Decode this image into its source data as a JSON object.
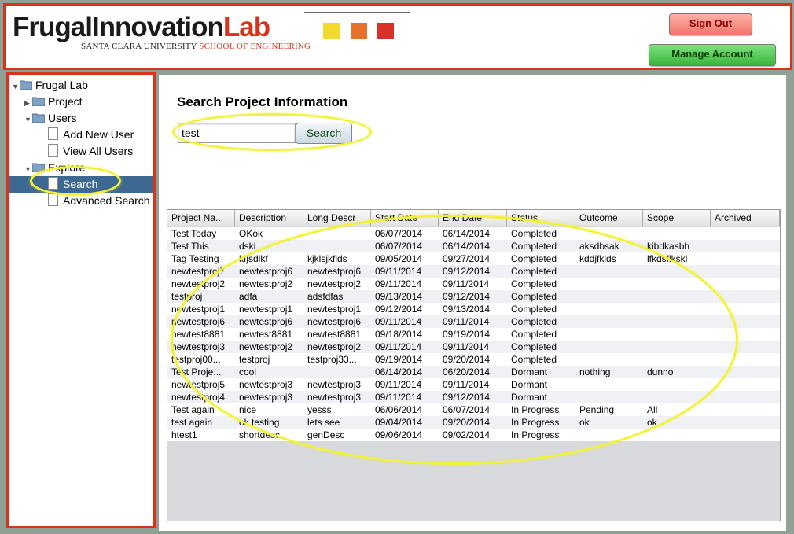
{
  "header": {
    "logo_part1": "FrugalInnovation",
    "logo_part2": "Lab",
    "logo_sub1": "SANTA CLARA UNIVERSITY",
    "logo_sub2": "SCHOOL OF ENGINEERING",
    "squares": [
      "#f2d92a",
      "#e8702a",
      "#d8302a"
    ],
    "signout_label": "Sign Out",
    "manage_label": "Manage Account"
  },
  "tree": {
    "root": "Frugal Lab",
    "project": "Project",
    "users": "Users",
    "add_user": "Add New User",
    "view_users": "View All Users",
    "explore": "Explore",
    "search": "Search",
    "advanced_search": "Advanced Search"
  },
  "main": {
    "title": "Search Project Information",
    "search_value": "test",
    "search_button": "Search"
  },
  "table": {
    "columns": [
      "Project Na...",
      "Description",
      "Long Descr",
      "Start Date",
      "End Date",
      "Status",
      "Outcome",
      "Scope",
      "Archived"
    ],
    "rows": [
      [
        "Test Today",
        "OKok",
        "",
        "06/07/2014",
        "06/14/2014",
        "Completed",
        "",
        "",
        ""
      ],
      [
        "Test This",
        "dski",
        "",
        "06/07/2014",
        "06/14/2014",
        "Completed",
        "aksdbsak",
        "kibdkasbh",
        ""
      ],
      [
        "Tag Testing",
        "kfjsdlkf",
        "kjklsjkflds",
        "09/05/2014",
        "09/27/2014",
        "Completed",
        "kddjfklds",
        "lfkdsflkskl",
        ""
      ],
      [
        "newtestproj7",
        "newtestproj6",
        "newtestproj6",
        "09/11/2014",
        "09/12/2014",
        "Completed",
        "",
        "",
        ""
      ],
      [
        "newtestproj2",
        "newtestproj2",
        "newtestproj2",
        "09/11/2014",
        "09/11/2014",
        "Completed",
        "",
        "",
        ""
      ],
      [
        "testproj",
        "adfa",
        "adsfdfas",
        "09/13/2014",
        "09/12/2014",
        "Completed",
        "",
        "",
        ""
      ],
      [
        "newtestproj1",
        "newtestproj1",
        "newtestproj1",
        "09/12/2014",
        "09/13/2014",
        "Completed",
        "",
        "",
        ""
      ],
      [
        "newtestproj6",
        "newtestproj6",
        "newtestproj6",
        "09/11/2014",
        "09/11/2014",
        "Completed",
        "",
        "",
        ""
      ],
      [
        "newtest8881",
        "newtest8881",
        "newtest8881",
        "09/18/2014",
        "09/19/2014",
        "Completed",
        "",
        "",
        ""
      ],
      [
        "newtestproj3",
        "newtestproj2",
        "newtestproj2",
        "09/11/2014",
        "09/11/2014",
        "Completed",
        "",
        "",
        ""
      ],
      [
        "testproj00...",
        "testproj",
        "testproj33...",
        "09/19/2014",
        "09/20/2014",
        "Completed",
        "",
        "",
        ""
      ],
      [
        "Test Proje...",
        "cool",
        "",
        "06/14/2014",
        "06/20/2014",
        "Dormant",
        "nothing",
        "dunno",
        ""
      ],
      [
        "newtestproj5",
        "newtestproj3",
        "newtestproj3",
        "09/11/2014",
        "09/11/2014",
        "Dormant",
        "",
        "",
        ""
      ],
      [
        "newtestproj4",
        "newtestproj3",
        "newtestproj3",
        "09/11/2014",
        "09/12/2014",
        "Dormant",
        "",
        "",
        ""
      ],
      [
        "Test again",
        "nice",
        "yesss",
        "06/06/2014",
        "06/07/2014",
        "In Progress",
        "Pending",
        "All",
        ""
      ],
      [
        "test again",
        "ok testing",
        "lets see",
        "09/04/2014",
        "09/20/2014",
        "In Progress",
        "ok",
        "ok",
        ""
      ],
      [
        "htest1",
        "shortdesc",
        "genDesc",
        "09/06/2014",
        "09/02/2014",
        "In Progress",
        "",
        "",
        ""
      ]
    ]
  },
  "colors": {
    "accent_red": "#d8341c",
    "highlight_yellow": "#f2f23a",
    "selection_blue": "#3d6891"
  }
}
